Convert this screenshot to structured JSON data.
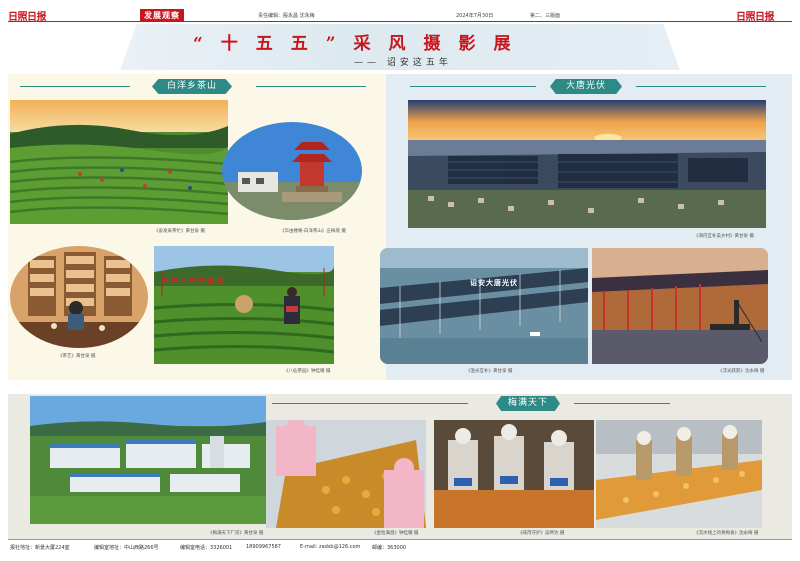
{
  "header": {
    "logo_left": "日照日报",
    "column_tag": "发展观察",
    "editors": "责任编辑：殷永昌  沈永梅",
    "date": "2024年7月30日",
    "page": "第二、三版面",
    "logo_right": "日照日报"
  },
  "title": {
    "main": "“十五五”采风摄影展",
    "sub": "—— 诏安这五年"
  },
  "sections": {
    "left": "白洋乡茶山",
    "right": "大唐光伏",
    "bottom": "梅满天下"
  },
  "captions": {
    "tea_hills": "《奋发采茶忙》黄甘泉 摄",
    "pavilion": "《华由楼阁·白洋茶山》庄梅境 摄",
    "tea_shop": "《茶艺》黄甘泉 摄",
    "tea_pickers": "《八仙茶园》钟桂耀 摄",
    "solar_aerial": "《海内互补美乡村》黄甘泉 摄",
    "solar_sea": "《渔光互补》黄甘泉 摄",
    "solar_fisher": "《浮光跃影》沈永梅 摄",
    "factory": "《梅满天下厂房》黄甘泉 摄",
    "sorting": "《金粒满盘》钟桂耀 摄",
    "workers": "《味丙守护》吴畔达 摄",
    "line": "《流水线上的青梅食》沈永梅 摄"
  },
  "photo_text": {
    "tea_banner": "白洋乡产茶基地",
    "solar_banner": "诏安大唐光伏"
  },
  "footer": {
    "address": "报社地址：新景大厦224室",
    "editorial": "编辑室地址：中山西路266号",
    "phone": "编辑室电话：3326001",
    "mobile": "18909967587",
    "email": "E-mail: zadsb@126.com",
    "postcode": "邮编：363000"
  },
  "colors": {
    "brand_red": "#c8161d",
    "teal": "#2e8a86",
    "left_panel": "#fbf8e8",
    "right_panel": "#e3ecf3",
    "bottom_panel": "#eaeae3"
  }
}
